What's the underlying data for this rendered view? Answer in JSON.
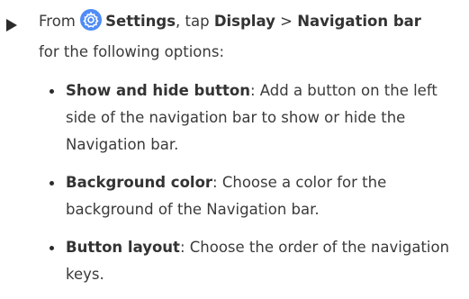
{
  "step": {
    "prefix": "From",
    "settings_label": "Settings",
    "tap_text": ", tap",
    "display_label": "Display",
    "separator": ">",
    "navigation_bar_label": "Navigation bar",
    "line2": "for the following options:"
  },
  "options": [
    {
      "title": "Show and hide button",
      "description": ": Add a button on the left side of the navigation bar to show or hide the Navigation bar."
    },
    {
      "title": "Background color",
      "description": ": Choose a color for the background of the Navigation bar."
    },
    {
      "title": "Button layout",
      "description": ": Choose the order of the navigation keys."
    }
  ],
  "icons": {
    "step_marker": "right-triangle-icon",
    "settings": "settings-gear-icon"
  },
  "colors": {
    "text": "#3a3a3a",
    "settings_icon_bg": "#4f8cf7",
    "settings_icon_fg": "#ffffff"
  }
}
